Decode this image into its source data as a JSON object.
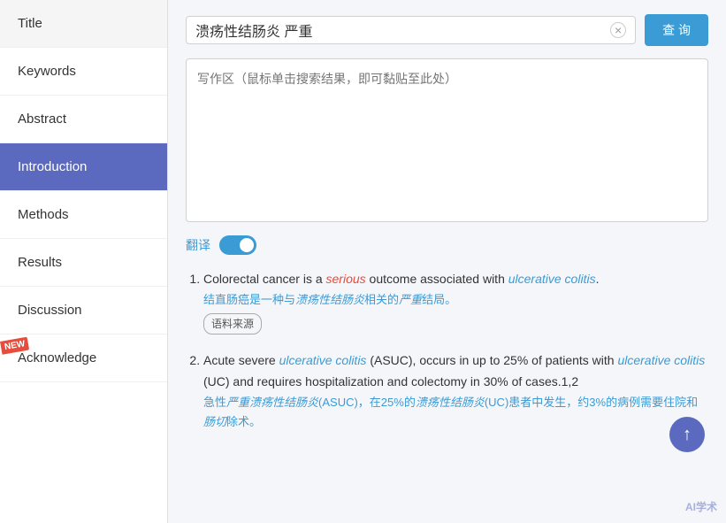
{
  "sidebar": {
    "items": [
      {
        "id": "title",
        "label": "Title",
        "active": false,
        "new": false
      },
      {
        "id": "keywords",
        "label": "Keywords",
        "active": false,
        "new": false
      },
      {
        "id": "abstract",
        "label": "Abstract",
        "active": false,
        "new": false
      },
      {
        "id": "introduction",
        "label": "Introduction",
        "active": true,
        "new": false
      },
      {
        "id": "methods",
        "label": "Methods",
        "active": false,
        "new": false
      },
      {
        "id": "results",
        "label": "Results",
        "active": false,
        "new": false
      },
      {
        "id": "discussion",
        "label": "Discussion",
        "active": false,
        "new": false
      },
      {
        "id": "acknowledge",
        "label": "Acknowledge",
        "active": false,
        "new": true
      }
    ]
  },
  "search": {
    "value": "溃疡性结肠炎 严重",
    "clear_label": "×",
    "query_label": "查 询"
  },
  "writing_area": {
    "placeholder": "写作区（鼠标单击搜索结果，即可黏贴至此处）"
  },
  "translate": {
    "label": "翻译"
  },
  "results": [
    {
      "id": 1,
      "en_parts": [
        {
          "text": "Colorectal cancer is a ",
          "style": "normal"
        },
        {
          "text": "serious",
          "style": "italic-red"
        },
        {
          "text": " outcome associated with ",
          "style": "normal"
        },
        {
          "text": "ulcerative colitis",
          "style": "italic-blue"
        },
        {
          "text": ".",
          "style": "normal"
        }
      ],
      "cn_text": "结直肠癌是一种与溃疡性结肠炎相关的严重结局。",
      "cn_parts": [
        {
          "text": "结直肠癌是一种与",
          "style": "normal-cn"
        },
        {
          "text": "溃疡性结肠炎",
          "style": "italic-cn-blue"
        },
        {
          "text": "相关的",
          "style": "normal-cn"
        },
        {
          "text": "严重",
          "style": "italic-cn-blue"
        },
        {
          "text": "结局。",
          "style": "normal-cn"
        }
      ],
      "source_badge": "语料来源"
    },
    {
      "id": 2,
      "en_parts": [
        {
          "text": "Acute severe ",
          "style": "normal"
        },
        {
          "text": "ulcerative colitis",
          "style": "italic-blue"
        },
        {
          "text": " (ASUC), occurs in up to 25% of patients with ",
          "style": "normal"
        },
        {
          "text": "ulcerative colitis",
          "style": "italic-blue"
        },
        {
          "text": " (UC) and requires hospitalization and colectomy in 30% of cases.1,2",
          "style": "normal"
        }
      ],
      "cn_text": "急性严重溃疡性结肠炎(ASUC)，在25%的溃疡性结肠炎(UC)患者中发生，约3%的病例需要住院和肠切除术。",
      "cn_parts": [
        {
          "text": "急性",
          "style": "normal-cn"
        },
        {
          "text": "严重溃疡性结肠炎",
          "style": "italic-cn-blue"
        },
        {
          "text": "(ASUC)，在25%的",
          "style": "normal-cn"
        },
        {
          "text": "溃疡性结肠炎",
          "style": "italic-cn-blue"
        },
        {
          "text": "(UC)患者中发生，约3%的病例需要住院和",
          "style": "normal-cn"
        },
        {
          "text": "肠切",
          "style": "italic-cn-blue"
        },
        {
          "text": "除术。",
          "style": "normal-cn"
        }
      ],
      "source_badge": null
    }
  ],
  "scroll_up_icon": "↑",
  "watermark": "AI学术"
}
